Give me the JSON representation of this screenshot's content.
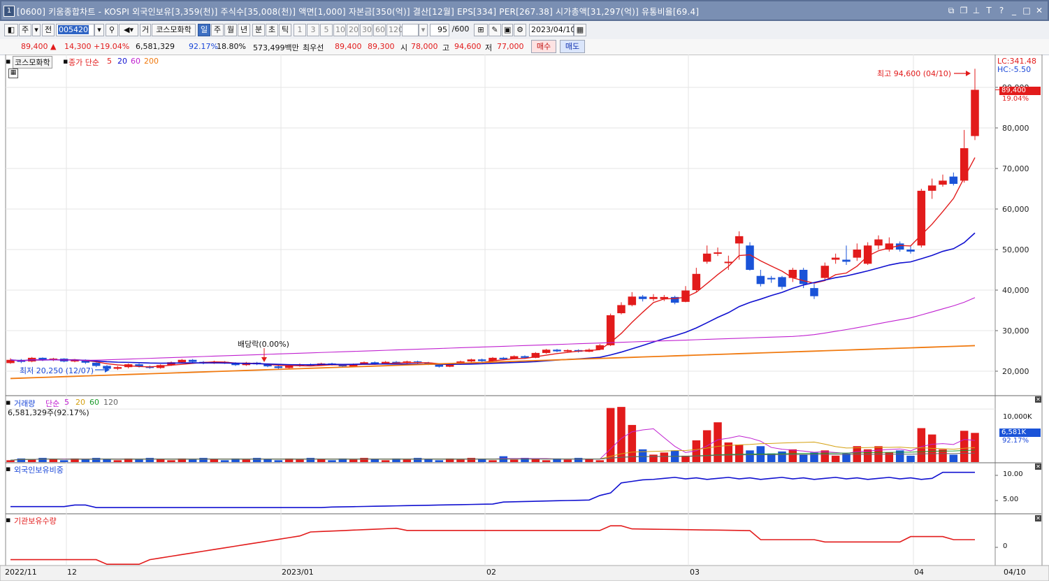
{
  "window": {
    "icon_number": "1",
    "title": "[0600] 키움종합차트 - KOSPI 외국인보유[3,359(천)] 주식수[35,008(천)] 액면[1,000] 자본금[350(억)] 결산[12월] EPS[334] PER[267.38] 시가총액[31,297(억)] 유통비율[69.4]"
  },
  "toolbar": {
    "period_label": "주",
    "prev_label": "전",
    "code_value": "005420",
    "trade_label": "거",
    "stock_name": "코스모화학",
    "intervals": [
      "일",
      "주",
      "월",
      "년",
      "분",
      "초",
      "틱"
    ],
    "active_interval": "일",
    "minute_options": [
      "1",
      "3",
      "5",
      "10",
      "20",
      "30",
      "60",
      "120"
    ],
    "count_value": "95",
    "count_total": "/600",
    "date_value": "2023/04/10"
  },
  "quote": {
    "price": "89,400",
    "change": "14,300",
    "change_pct": "+19.04%",
    "volume": "6,581,329",
    "volume_ratio": "92.17%",
    "turnover": "18.80%",
    "amount": "573,499백만",
    "best_bid_label": "최우선",
    "best_ask": "89,400",
    "best_bid": "89,300",
    "open_label": "시",
    "open": "78,000",
    "high_label": "고",
    "high": "94,600",
    "low_label": "저",
    "low": "77,000",
    "buy_label": "매수",
    "sell_label": "매도"
  },
  "price_panel": {
    "stock_tag": "코스모화학",
    "legend_close": "종가 단순",
    "ma_labels": [
      "5",
      "20",
      "60",
      "200"
    ],
    "lc": "LC:341.48",
    "hc": "HC:-5.50",
    "high_note": "최고 94,600 (04/10)",
    "low_note": "최저 20,250 (12/07)",
    "dividend_note": "배당락(0.00%)",
    "current_price_tag": "89,400",
    "current_pct_tag": "19.04%",
    "y_ticks": [
      "90,000",
      "80,000",
      "70,000",
      "60,000",
      "50,000",
      "40,000",
      "30,000",
      "20,000"
    ]
  },
  "volume_panel": {
    "title": "거래량",
    "legend": "단순",
    "ma_labels": [
      "5",
      "20",
      "60",
      "120"
    ],
    "current_text": "6,581,329주(92.17%)",
    "tag_value": "6,581K",
    "tag_pct": "92.17%",
    "y_tick": "10,000K"
  },
  "foreign_panel": {
    "title": "외국인보유비중",
    "y_ticks": [
      "10.00",
      "5.00"
    ]
  },
  "inst_panel": {
    "title": "기관보유수량",
    "y_tick": "0"
  },
  "x_axis": {
    "labels": [
      "2022/11",
      "12",
      "2023/01",
      "02",
      "03",
      "04"
    ],
    "right_label": "04/10"
  },
  "colors": {
    "up": "#e21b1b",
    "down": "#1a53d8",
    "ma5": "#e21b1b",
    "ma20": "#1010d0",
    "ma60": "#c020d0",
    "ma200": "#f07a10"
  }
}
